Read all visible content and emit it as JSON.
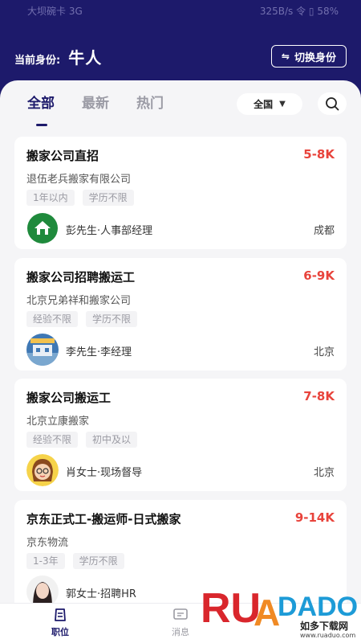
{
  "status": {
    "left": "大坝碗卡 3G",
    "right": "325B/s  令  ▯ 58%"
  },
  "header": {
    "identity_label": "当前身份:",
    "identity_value": "牛人",
    "switch_label": "切换身份"
  },
  "tabs": [
    {
      "label": "全部",
      "active": true
    },
    {
      "label": "最新",
      "active": false
    },
    {
      "label": "热门",
      "active": false
    }
  ],
  "filter": {
    "region": "全国"
  },
  "jobs": [
    {
      "title": "搬家公司直招",
      "salary": "5-8K",
      "company": "退伍老兵搬家有限公司",
      "tags": [
        "1年以内",
        "学历不限"
      ],
      "contact": "彭先生·人事部经理",
      "city": "成都",
      "avatar": "green-logo"
    },
    {
      "title": "搬家公司招聘搬运工",
      "salary": "6-9K",
      "company": "北京兄弟祥和搬家公司",
      "tags": [
        "经验不限",
        "学历不限"
      ],
      "contact": "李先生·李经理",
      "city": "北京",
      "avatar": "photo-logo"
    },
    {
      "title": "搬家公司搬运工",
      "salary": "7-8K",
      "company": "北京立康搬家",
      "tags": [
        "经验不限",
        "初中及以"
      ],
      "contact": "肖女士·现场督导",
      "city": "北京",
      "avatar": "cartoon-girl"
    },
    {
      "title": "京东正式工-搬运师-日式搬家",
      "salary": "9-14K",
      "company": "京东物流",
      "tags": [
        "1-3年",
        "学历不限"
      ],
      "contact": "郭女士·招聘HR",
      "city": "",
      "avatar": "woman-photo"
    }
  ],
  "nav": [
    {
      "label": "职位",
      "active": true
    },
    {
      "label": "消息",
      "active": false
    }
  ],
  "watermark": {
    "brand": "RUANDADO",
    "text": "如多下载网",
    "url": "www.ruaduo.com"
  },
  "colors": {
    "primary": "#1d1a6b",
    "salary": "#e8433b",
    "background": "#f5f5f7"
  }
}
